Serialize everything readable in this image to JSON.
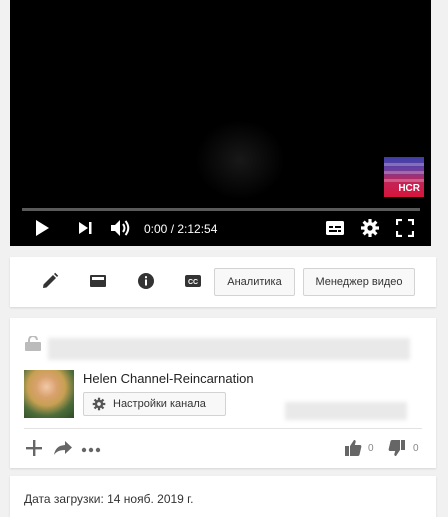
{
  "player": {
    "time_display": "0:00 / 2:12:54",
    "logo_text": "HCR",
    "progress": 0.0
  },
  "toolbar": {
    "analytics_label": "Аналитика",
    "video_manager_label": "Менеджер видео"
  },
  "channel": {
    "name": "Helen Channel-Reincarnation",
    "settings_label": "Настройки канала"
  },
  "ratings": {
    "likes": "0",
    "dislikes": "0"
  },
  "details": {
    "upload_date": "Дата загрузки: 14 нояб. 2019 г."
  },
  "colors": {
    "player_bg": "#000000",
    "page_bg": "#f1f1f1"
  },
  "icons": [
    "play-icon",
    "next-icon",
    "volume-icon",
    "subtitles-icon",
    "settings-gear-icon",
    "fullscreen-icon",
    "edit-pencil-icon",
    "card-icon",
    "info-icon",
    "cc-icon",
    "lock-icon",
    "gear-icon",
    "add-icon",
    "share-icon",
    "more-icon",
    "thumbs-up-icon",
    "thumbs-down-icon"
  ]
}
